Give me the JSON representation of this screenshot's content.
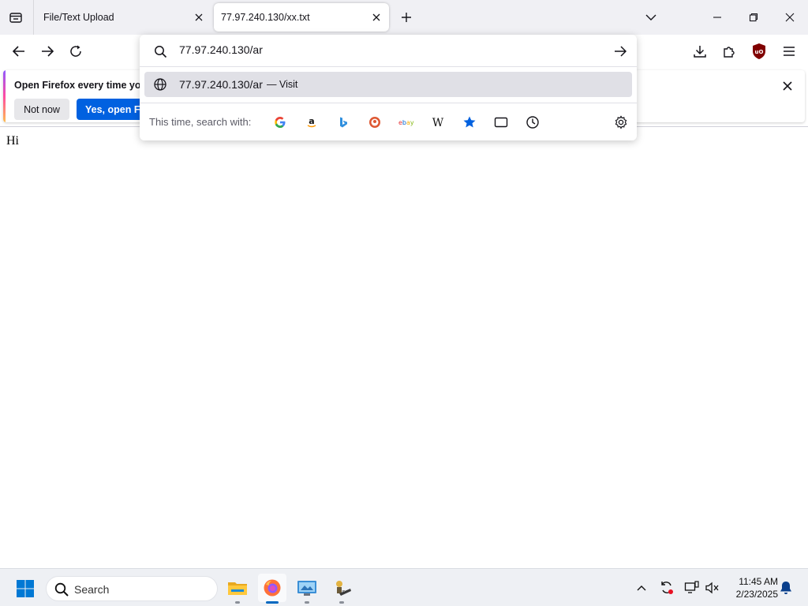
{
  "tabs": [
    {
      "title": "File/Text Upload",
      "active": false
    },
    {
      "title": "77.97.240.130/xx.txt",
      "active": true
    }
  ],
  "notification": {
    "message": "Open Firefox every time you",
    "not_now_label": "Not now",
    "yes_label": "Yes, open Fi"
  },
  "urlbar": {
    "value": "77.97.240.130/ar",
    "suggestion": {
      "url": "77.97.240.130/ar",
      "action": "— Visit"
    },
    "search_with_label": "This time, search with:",
    "engines": [
      "google-icon",
      "amazon-icon",
      "bing-icon",
      "duckduckgo-icon",
      "ebay-icon",
      "wikipedia-icon",
      "bookmarks-icon",
      "tabs-icon",
      "history-icon"
    ]
  },
  "page": {
    "text": "Hi"
  },
  "taskbar": {
    "search_placeholder": "Search",
    "apps": [
      "file-explorer-icon",
      "firefox-icon",
      "control-panel-icon",
      "app-icon"
    ],
    "time": "11:45 AM",
    "date": "2/23/2025"
  },
  "colors": {
    "accent": "#0061e0",
    "tab_strip": "#f0f0f4",
    "ublock": "#800000",
    "windows_blue": "#0078d4"
  }
}
